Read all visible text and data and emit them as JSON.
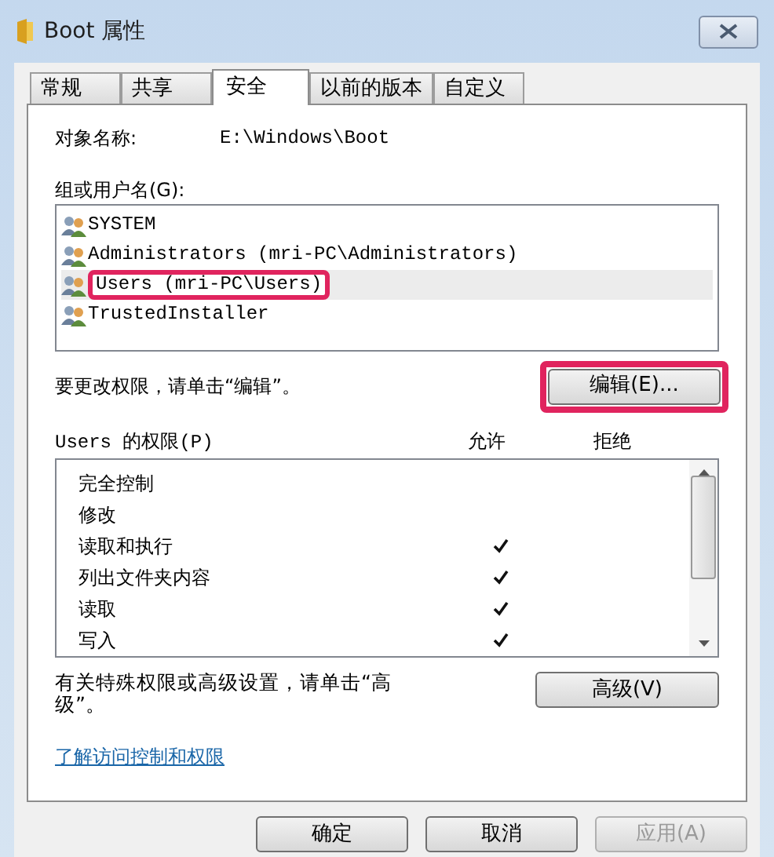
{
  "window": {
    "title": "Boot 属性"
  },
  "tabs": [
    {
      "label": "常规",
      "selected": false
    },
    {
      "label": "共享",
      "selected": false
    },
    {
      "label": "安全",
      "selected": true
    },
    {
      "label": "以前的版本",
      "selected": false
    },
    {
      "label": "自定义",
      "selected": false
    }
  ],
  "object_name": {
    "label": "对象名称:",
    "value": "E:\\Windows\\Boot"
  },
  "groups": {
    "label": "组或用户名(G):",
    "items": [
      {
        "name": "SYSTEM",
        "selected": false,
        "highlighted": false
      },
      {
        "name": "Administrators (mri-PC\\Administrators)",
        "selected": false,
        "highlighted": false
      },
      {
        "name": "Users (mri-PC\\Users)",
        "selected": true,
        "highlighted": true
      },
      {
        "name": "TrustedInstaller",
        "selected": false,
        "highlighted": false
      }
    ]
  },
  "edit_hint": "要更改权限，请单击“编辑”。",
  "edit_button": {
    "label": "编辑(E)...",
    "highlighted": true
  },
  "permissions": {
    "label": "Users 的权限(P)",
    "allow_header": "允许",
    "deny_header": "拒绝",
    "items": [
      {
        "name": "完全控制",
        "allow": false,
        "deny": false
      },
      {
        "name": "修改",
        "allow": false,
        "deny": false
      },
      {
        "name": "读取和执行",
        "allow": true,
        "deny": false
      },
      {
        "name": "列出文件夹内容",
        "allow": true,
        "deny": false
      },
      {
        "name": "读取",
        "allow": true,
        "deny": false
      },
      {
        "name": "写入",
        "allow": true,
        "deny": false
      }
    ]
  },
  "advanced_hint": "有关特殊权限或高级设置，请单击“高级”。",
  "advanced_button": "高级(V)",
  "learn_link": "了解访问控制和权限",
  "buttons": [
    {
      "label": "确定",
      "disabled": false
    },
    {
      "label": "取消",
      "disabled": false
    },
    {
      "label": "应用(A)",
      "disabled": true
    }
  ]
}
